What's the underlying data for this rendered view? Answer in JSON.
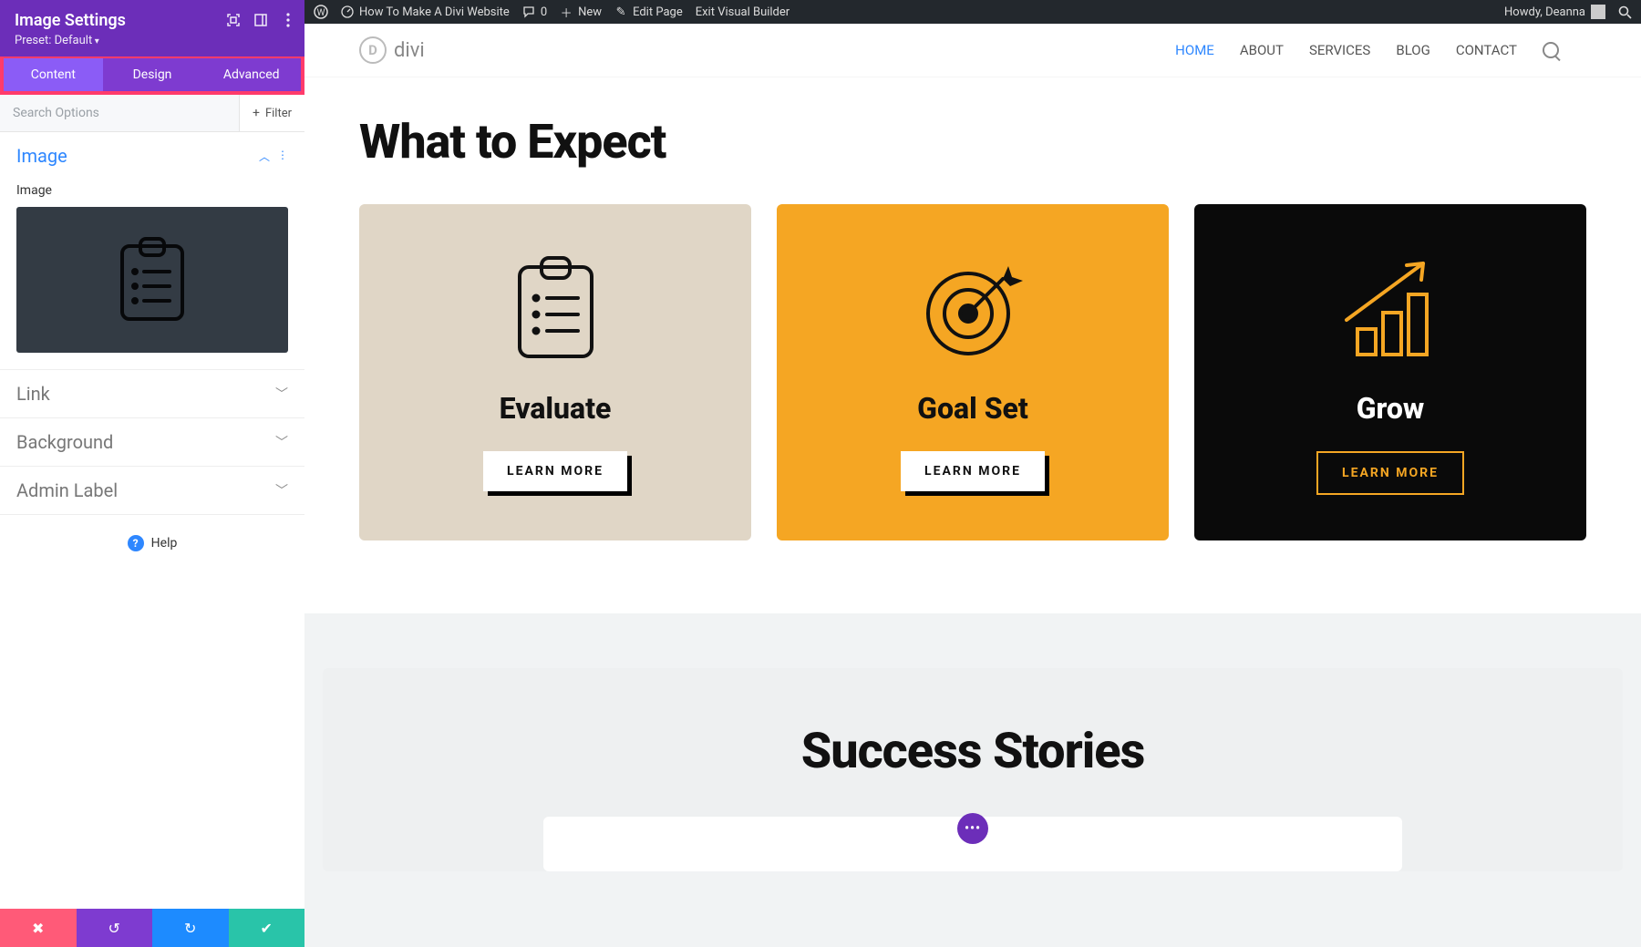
{
  "sidebar": {
    "title": "Image Settings",
    "preset": "Preset: Default",
    "tabs": {
      "content": "Content",
      "design": "Design",
      "advanced": "Advanced"
    },
    "search_placeholder": "Search Options",
    "filter_label": "Filter",
    "sections": {
      "image": {
        "title": "Image",
        "field_label": "Image"
      },
      "link": "Link",
      "background": "Background",
      "admin_label": "Admin Label"
    },
    "help": "Help"
  },
  "wpbar": {
    "site_title": "How To Make A Divi Website",
    "comments": "0",
    "new_label": "New",
    "edit_page": "Edit Page",
    "exit_vb": "Exit Visual Builder",
    "howdy": "Howdy, Deanna"
  },
  "site": {
    "logo_text": "divi",
    "nav": {
      "home": "HOME",
      "about": "ABOUT",
      "services": "SERVICES",
      "blog": "BLOG",
      "contact": "CONTACT"
    }
  },
  "page": {
    "heading": "What to Expect",
    "cards": [
      {
        "title": "Evaluate",
        "cta": "LEARN MORE"
      },
      {
        "title": "Goal Set",
        "cta": "LEARN MORE"
      },
      {
        "title": "Grow",
        "cta": "LEARN MORE"
      }
    ],
    "stories_heading": "Success Stories"
  }
}
